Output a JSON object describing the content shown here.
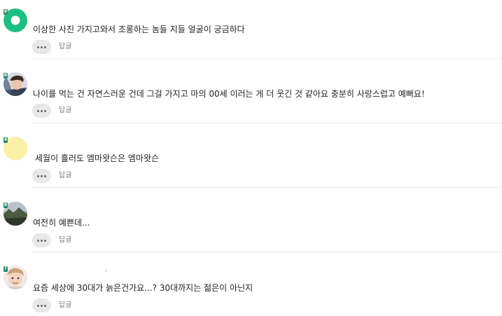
{
  "comments": [
    {
      "level": "8",
      "avatar": "green-ring-avatar",
      "text": "이상한 사진 가지고와서 조롱하는 놈들 지들 얼굴이 궁금하다",
      "reply_label": "답글"
    },
    {
      "level": "8",
      "avatar": "photo-avatar-man",
      "text": "나이를 먹는 건 자연스러운 건데 그걸 가지고 마의 00세 이러는 게 더 웃긴 것 같아요 충분히 사랑스럽고 예뻐요!",
      "reply_label": "답글"
    },
    {
      "level": "4",
      "avatar": "yellow-circle-avatar",
      "text": "세월이 흘러도 엠마왓슨은 엠마왓슨",
      "reply_label": "답글"
    },
    {
      "level": "8",
      "avatar": "landscape-avatar",
      "text": "여전히 예쁜데...",
      "reply_label": "답글"
    },
    {
      "level": "7",
      "avatar": "photo-avatar-child",
      "text": "요즘 세상에 30대가 늙은건가요...? 30대까지는 젊은이 아닌지",
      "reply_label": "답글"
    }
  ],
  "colors": {
    "green_avatar": "#1bbf83",
    "yellow_avatar": "#fbf0a6",
    "level_badge": "#2f8a6a",
    "more_button_bg": "#e8e8e8",
    "divider": "#ececec"
  }
}
